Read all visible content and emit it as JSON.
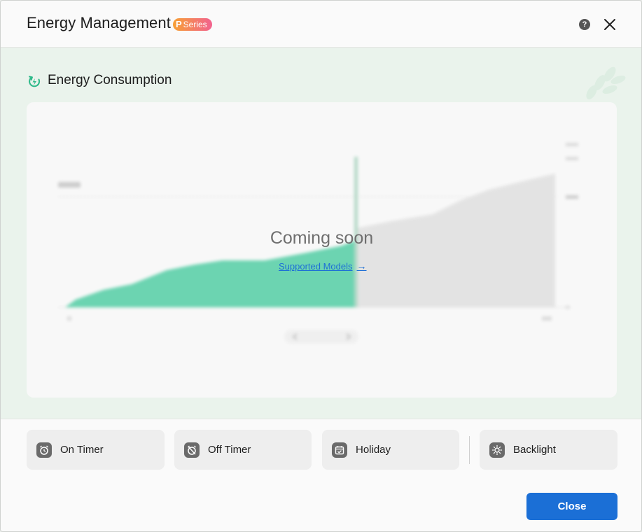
{
  "header": {
    "title": "Energy Management",
    "badge_letter": "P",
    "badge_text": "Series",
    "help_label": "?"
  },
  "section": {
    "title": "Energy Consumption"
  },
  "chart_card": {
    "coming_soon": "Coming soon",
    "link_label": "Supported Models",
    "link_arrow": "→"
  },
  "features": [
    {
      "label": "On Timer",
      "icon": "alarm-clock-icon"
    },
    {
      "label": "Off Timer",
      "icon": "alarm-off-icon"
    },
    {
      "label": "Holiday",
      "icon": "calendar-check-icon"
    },
    {
      "label": "Backlight",
      "icon": "sun-brightness-icon"
    }
  ],
  "footer": {
    "close_label": "Close"
  },
  "colors": {
    "accent": "#1b6fd6",
    "energy_green": "#3ec89a",
    "badge_start": "#f7a035",
    "badge_end": "#f2628f"
  }
}
